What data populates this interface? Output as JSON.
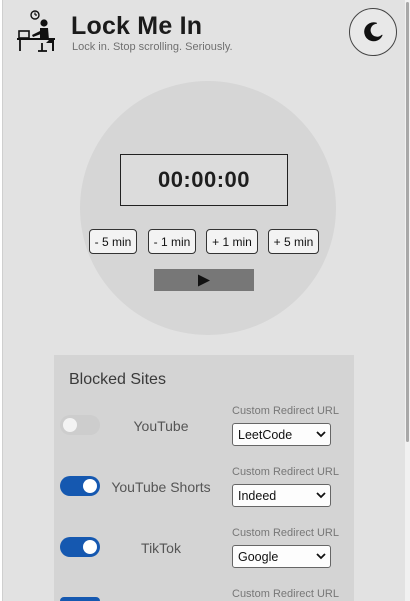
{
  "header": {
    "title": "Lock Me In",
    "tagline": "Lock in. Stop scrolling. Seriously."
  },
  "timer": {
    "display": "00:00:00",
    "adjust": [
      "- 5 min",
      "- 1 min",
      "+ 1 min",
      "+ 5 min"
    ],
    "play_icon": "play-icon"
  },
  "blocked": {
    "title": "Blocked Sites",
    "redirect_label": "Custom Redirect URL",
    "sites": [
      {
        "name": "YouTube",
        "enabled": false,
        "redirect": "LeetCode"
      },
      {
        "name": "YouTube Shorts",
        "enabled": true,
        "redirect": "Indeed"
      },
      {
        "name": "TikTok",
        "enabled": true,
        "redirect": "Google"
      },
      {
        "name": "",
        "enabled": true,
        "redirect": ""
      }
    ]
  },
  "colors": {
    "accent": "#1558b0",
    "panel_bg": "#e2e2e2",
    "circle_bg": "#d6d6d6"
  },
  "icons": {
    "logo": "desk-worker-clock-icon",
    "theme": "moon-icon",
    "dropdown": "chevron-down-icon"
  }
}
